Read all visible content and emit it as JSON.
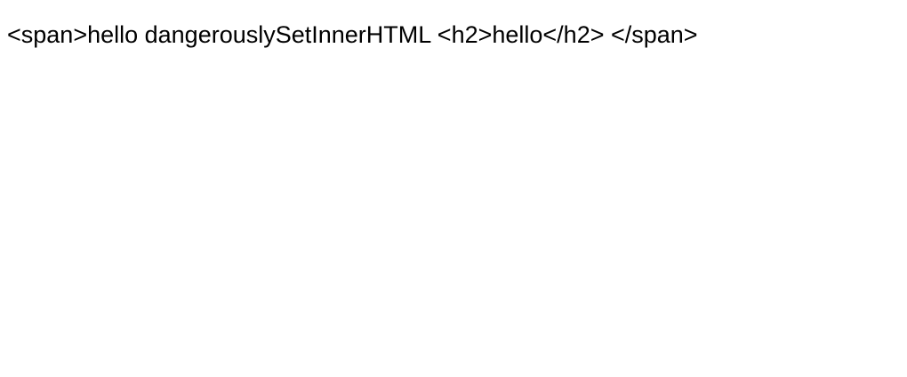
{
  "page": {
    "text": "<span>hello dangerouslySetInnerHTML <h2>hello</h2> </span>",
    "background_color": "#ffffff",
    "text_color": "#000000"
  }
}
